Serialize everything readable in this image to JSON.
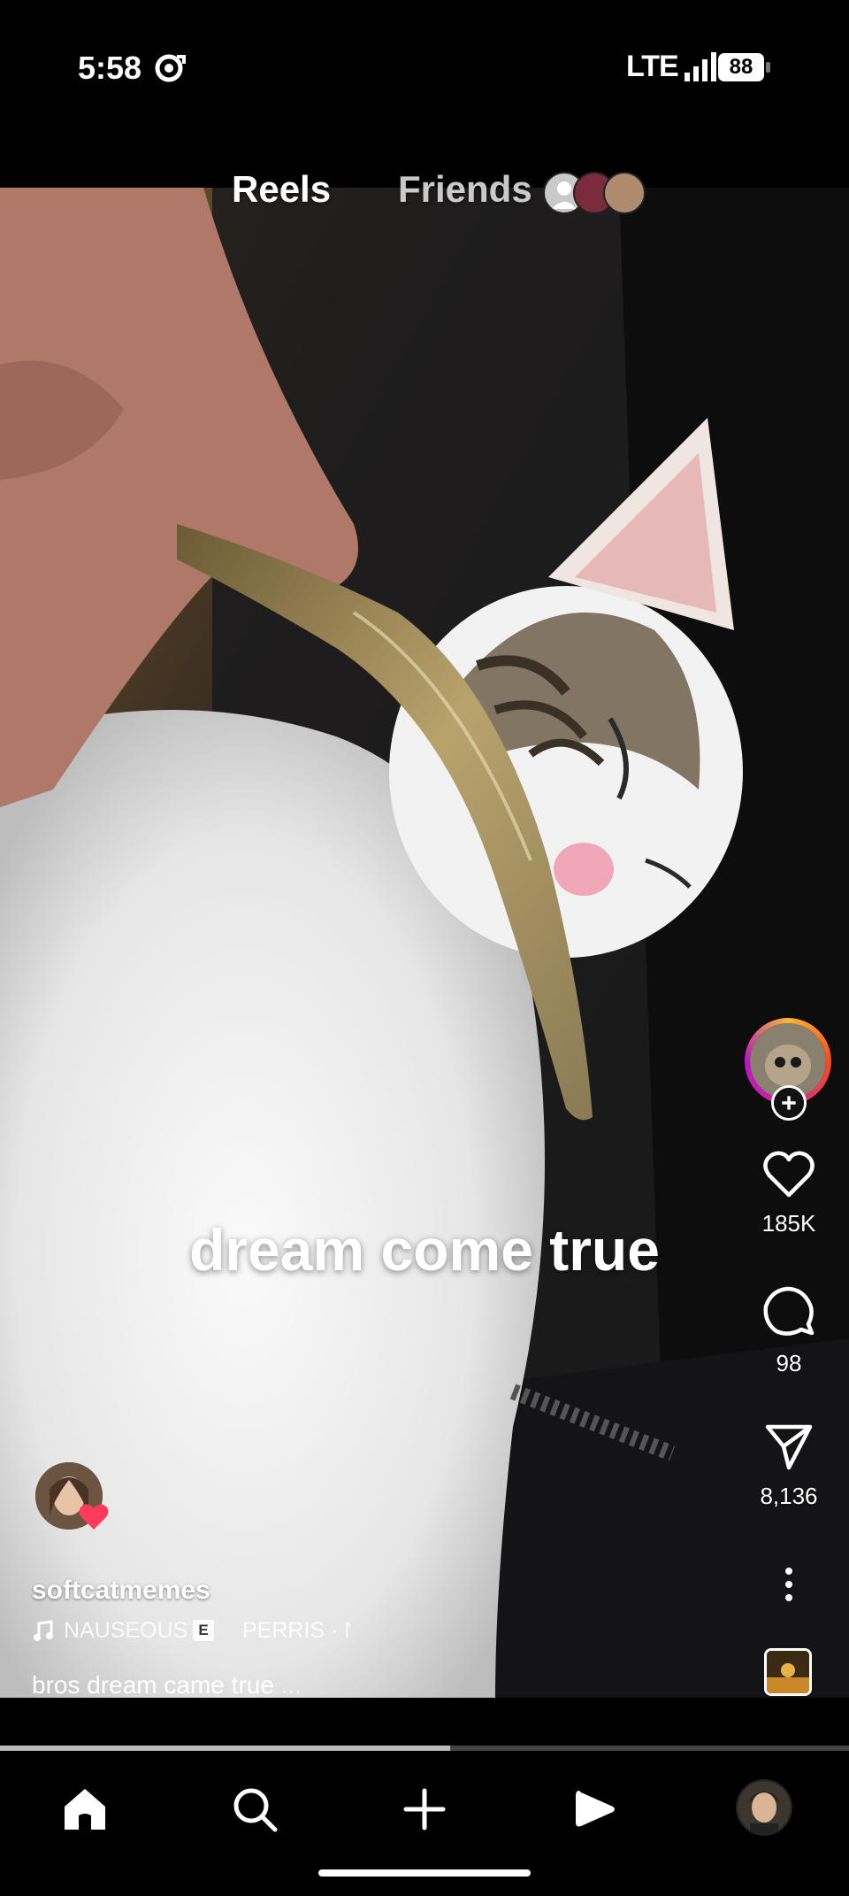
{
  "status_bar": {
    "time": "5:58",
    "network": "LTE",
    "battery": "88"
  },
  "top_tabs": {
    "reels": "Reels",
    "friends": "Friends"
  },
  "video": {
    "overlay_text": "dream come true"
  },
  "actions": {
    "likes": "185K",
    "comments": "98",
    "shares": "8,136"
  },
  "post": {
    "username": "softcatmemes",
    "music_title": "NAUSEOUS",
    "explicit_badge": "E",
    "music_artist": "PERRIS · N",
    "caption": "bros dream came true",
    "caption_more": "..."
  },
  "playback": {
    "progress": 0.53
  },
  "nav": {
    "items": [
      "home-icon",
      "search-icon",
      "create-icon",
      "reels-icon",
      "profile-avatar"
    ]
  },
  "colors": {
    "background": "#000000",
    "accent_heart": "#ff3b5c",
    "story_ring": [
      "#f7b733",
      "#fc4a1a",
      "#d6249f"
    ]
  }
}
